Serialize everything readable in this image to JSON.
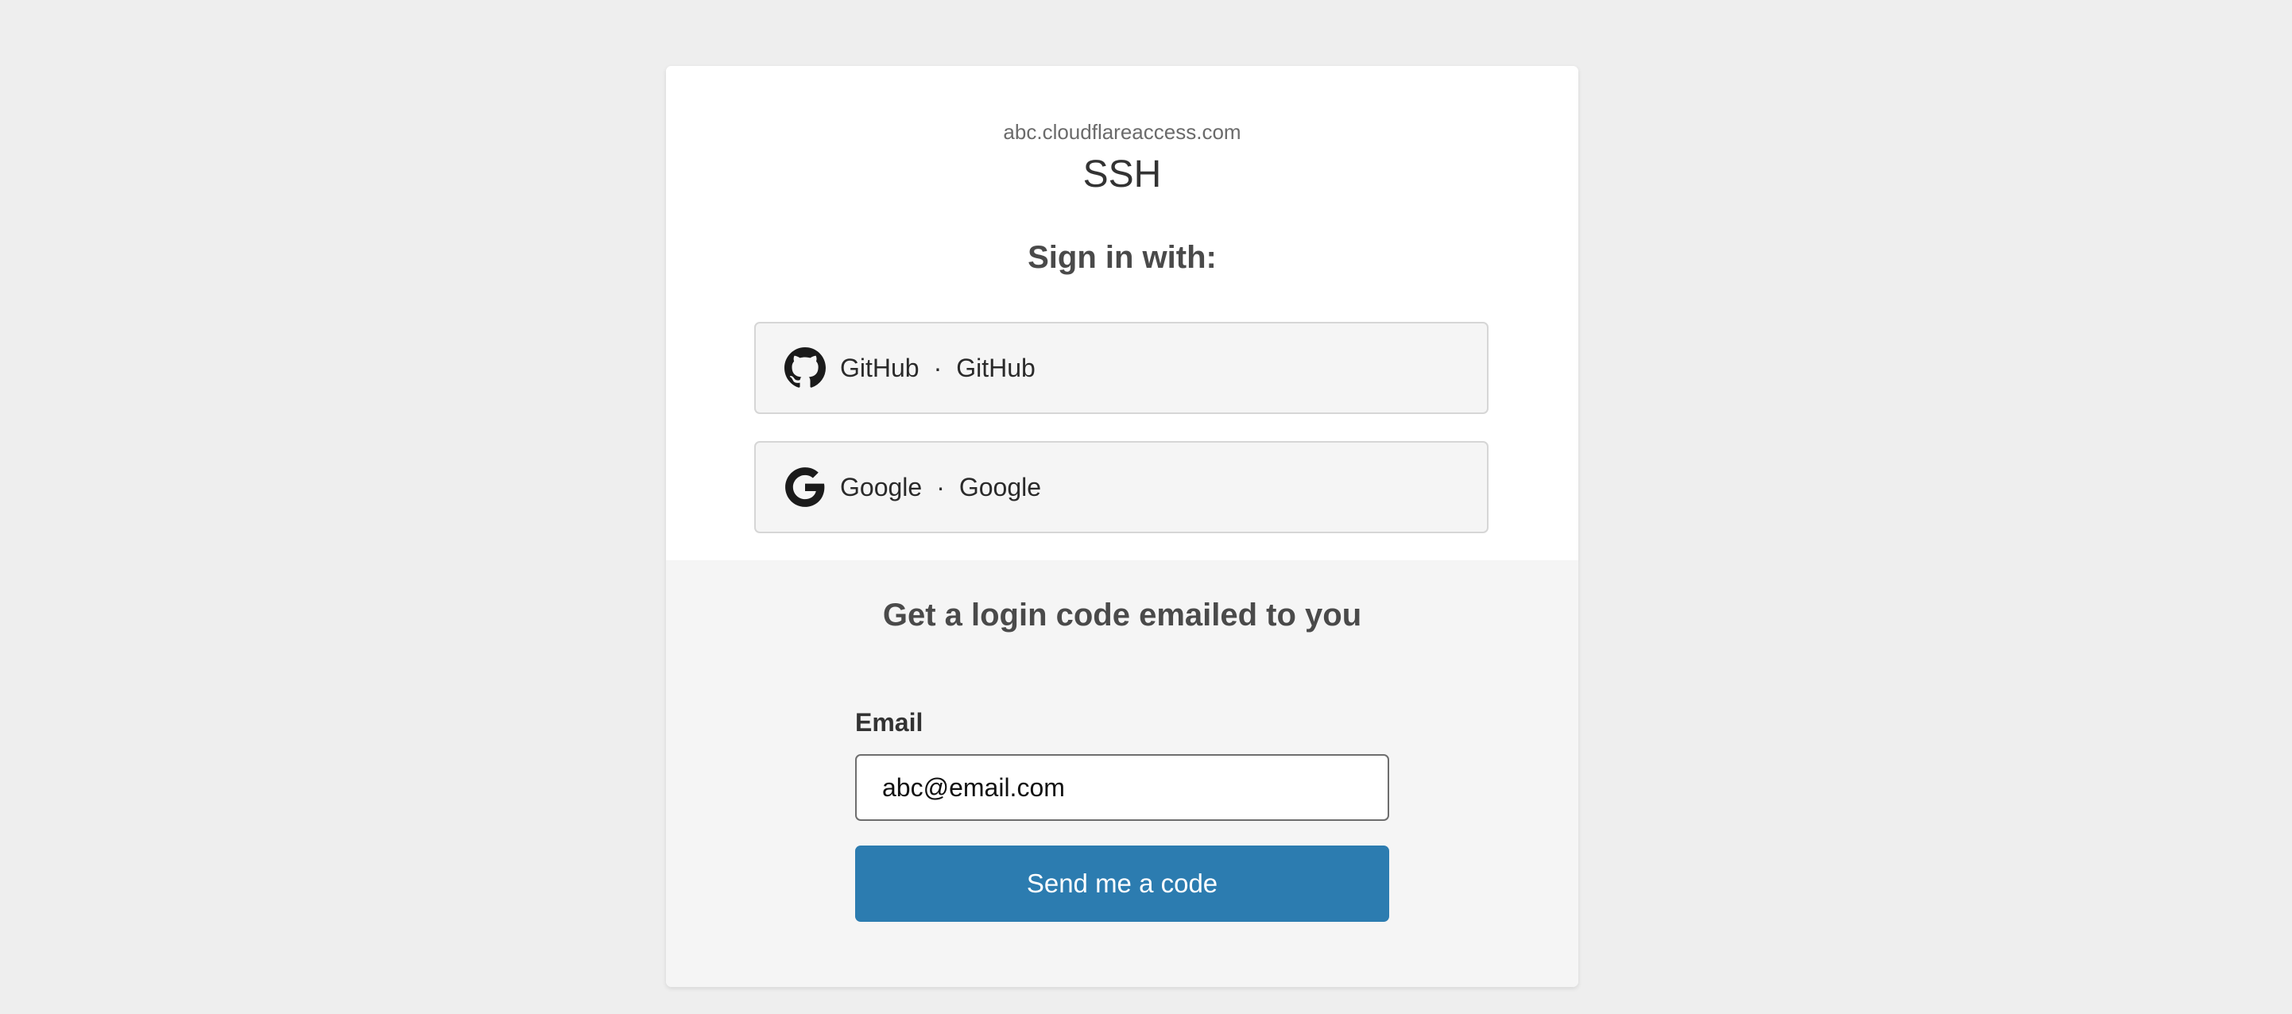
{
  "header": {
    "domain": "abc.cloudflareaccess.com",
    "app_name": "SSH"
  },
  "signin": {
    "heading": "Sign in with:",
    "providers": [
      {
        "name": "GitHub",
        "label": "GitHub",
        "separator": "·",
        "icon": "github-icon"
      },
      {
        "name": "Google",
        "label": "Google",
        "separator": "·",
        "icon": "google-icon"
      }
    ]
  },
  "otp": {
    "heading": "Get a login code emailed to you",
    "email_label": "Email",
    "email_value": "abc@email.com",
    "send_label": "Send me a code"
  },
  "colors": {
    "background": "#eeeeee",
    "card": "#ffffff",
    "bottom_panel": "#f5f5f5",
    "button_primary": "#2c7cb0",
    "idp_button_bg": "#f5f5f5"
  }
}
